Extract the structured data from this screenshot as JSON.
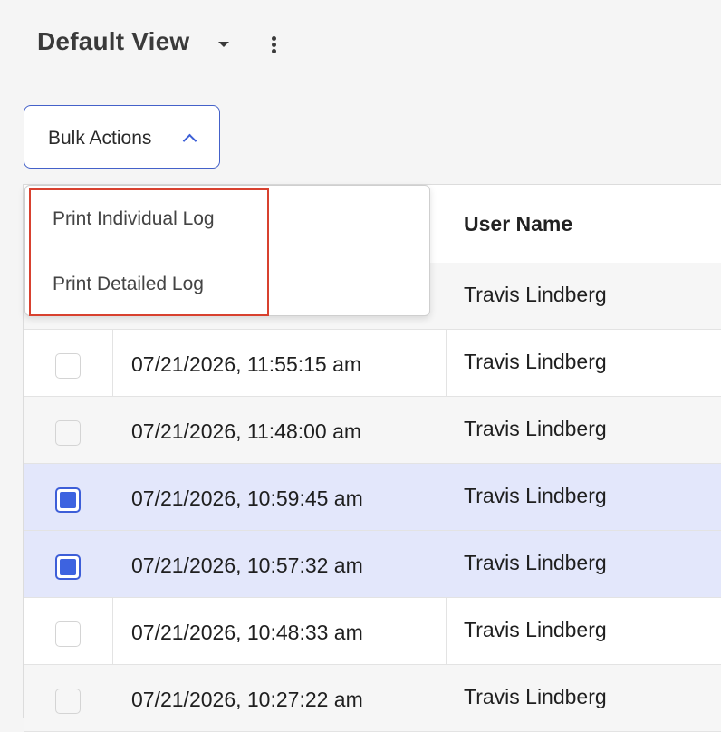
{
  "header": {
    "view_title": "Default View"
  },
  "bulk_actions": {
    "label": "Bulk Actions",
    "menu_items": [
      "Print Individual Log",
      "Print Detailed Log"
    ]
  },
  "table": {
    "columns": [
      "",
      "",
      "User Name"
    ],
    "rows": [
      {
        "date": "",
        "user": "Travis Lindberg",
        "checked": false
      },
      {
        "date": "07/21/2026, 11:55:15 am",
        "user": "Travis Lindberg",
        "checked": false
      },
      {
        "date": "07/21/2026, 11:48:00 am",
        "user": "Travis Lindberg",
        "checked": false
      },
      {
        "date": "07/21/2026, 10:59:45 am",
        "user": "Travis Lindberg",
        "checked": true
      },
      {
        "date": "07/21/2026, 10:57:32 am",
        "user": "Travis Lindberg",
        "checked": true
      },
      {
        "date": "07/21/2026, 10:48:33 am",
        "user": "Travis Lindberg",
        "checked": false
      },
      {
        "date": "07/21/2026, 10:27:22 am",
        "user": "Travis Lindberg",
        "checked": false
      }
    ]
  },
  "colors": {
    "accent": "#3d63e0",
    "selected_row": "#e3e7fb",
    "highlight_border": "#d8412f"
  }
}
